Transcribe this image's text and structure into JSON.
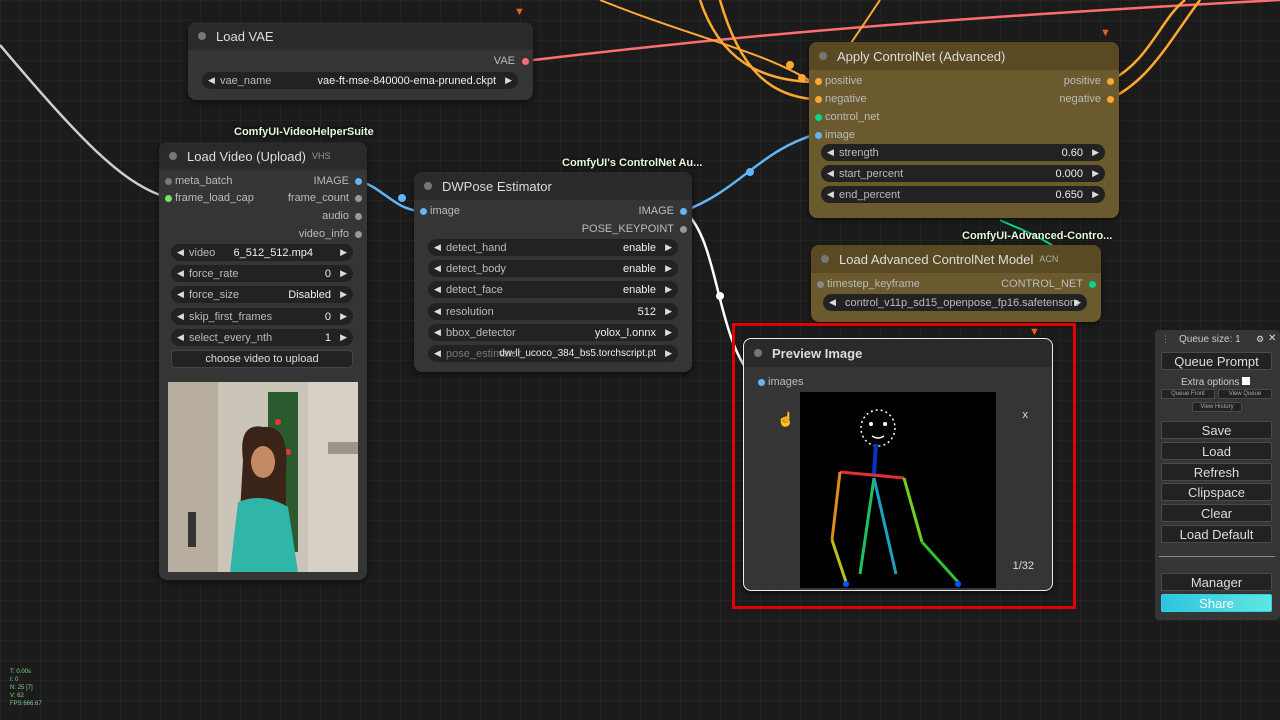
{
  "nodes": {
    "load_vae": {
      "title": "Load VAE",
      "output": "VAE",
      "widget": {
        "label": "vae_name",
        "value": "vae-ft-mse-840000-ema-pruned.ckpt"
      }
    },
    "load_video": {
      "badge": "ComfyUI-VideoHelperSuite",
      "title": "Load Video (Upload)",
      "title_suffix": "VHS",
      "inputs": [
        "meta_batch",
        "frame_load_cap"
      ],
      "outputs": [
        "IMAGE",
        "frame_count",
        "audio",
        "video_info"
      ],
      "widgets": [
        {
          "label": "video",
          "value": "6_512_512.mp4"
        },
        {
          "label": "force_rate",
          "value": "0"
        },
        {
          "label": "force_size",
          "value": "Disabled"
        },
        {
          "label": "skip_first_frames",
          "value": "0"
        },
        {
          "label": "select_every_nth",
          "value": "1"
        }
      ],
      "upload_button": "choose video to upload"
    },
    "dwpose": {
      "badge": "ComfyUI's ControlNet Au...",
      "title": "DWPose Estimator",
      "input": "image",
      "outputs": [
        "IMAGE",
        "POSE_KEYPOINT"
      ],
      "widgets": [
        {
          "label": "detect_hand",
          "value": "enable"
        },
        {
          "label": "detect_body",
          "value": "enable"
        },
        {
          "label": "detect_face",
          "value": "enable"
        },
        {
          "label": "resolution",
          "value": "512"
        },
        {
          "label": "bbox_detector",
          "value": "yolox_l.onnx"
        },
        {
          "label": "pose_estimator",
          "value": "dw-ll_ucoco_384_bs5.torchscript.pt"
        }
      ]
    },
    "apply_controlnet": {
      "title": "Apply ControlNet (Advanced)",
      "inputs": [
        "positive",
        "negative",
        "control_net",
        "image"
      ],
      "outputs": [
        "positive",
        "negative"
      ],
      "widgets": [
        {
          "label": "strength",
          "value": "0.60"
        },
        {
          "label": "start_percent",
          "value": "0.000"
        },
        {
          "label": "end_percent",
          "value": "0.650"
        }
      ]
    },
    "load_adv_controlnet": {
      "badge": "ComfyUI-Advanced-Contro...",
      "title": "Load Advanced ControlNet Model",
      "title_suffix": "ACN",
      "input": "timestep_keyframe",
      "output": "CONTROL_NET",
      "widget": {
        "value": "control_v11p_sd15_openpose_fp16.safetensors"
      }
    },
    "preview_image": {
      "title": "Preview Image",
      "input": "images",
      "close": "x",
      "counter": "1/32"
    }
  },
  "menu": {
    "queue_size": "Queue size: 1",
    "queue_prompt": "Queue Prompt",
    "extra_options": "Extra options",
    "queue_front": "Queue Front",
    "view_queue": "View Queue",
    "view_history": "View History",
    "buttons": [
      "Save",
      "Load",
      "Refresh",
      "Clipspace",
      "Clear",
      "Load Default"
    ],
    "manager": "Manager",
    "share": "Share"
  },
  "stats": [
    "T: 0.00s",
    "I: 0",
    "N: 25 [7]",
    "V: 62",
    "FPS:666.67"
  ],
  "colors": {
    "background": "#1b1b1b",
    "node": "#353535",
    "controlnet_node": "#6b5a2e",
    "selection": "#e00000",
    "share": "#2fd3e8",
    "image_pin": "#64b5f6",
    "conditioning_pin": "#ffa931",
    "vae_pin": "#ff6e6e",
    "controlnet_pin": "#00d78d"
  }
}
